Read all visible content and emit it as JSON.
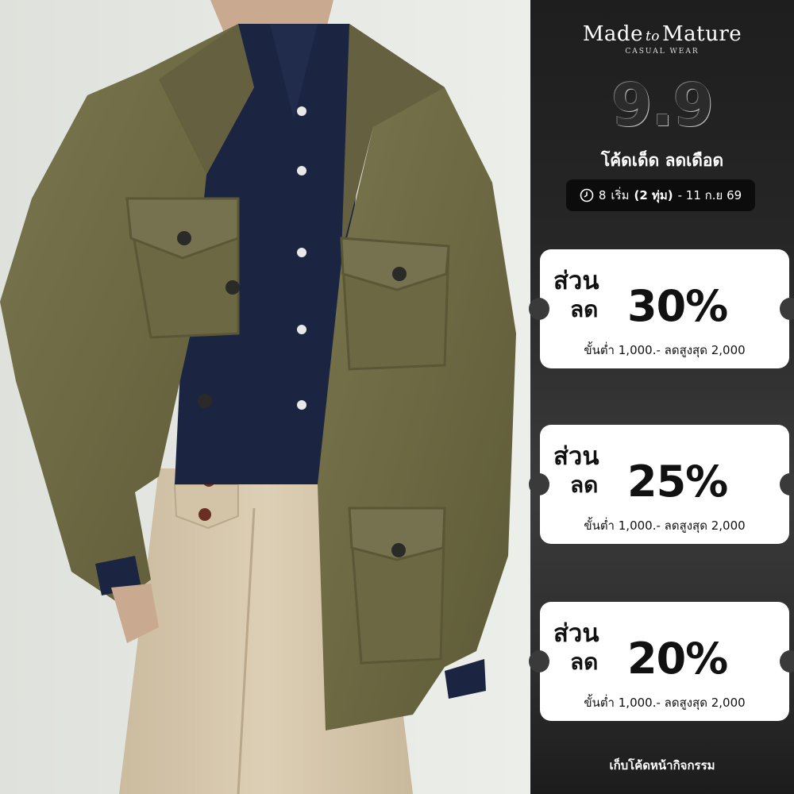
{
  "brand": {
    "name_left": "Made",
    "name_to": "to",
    "name_right": "Mature",
    "subtitle": "CASUAL WEAR"
  },
  "campaign": {
    "headline": "9.9",
    "slogan": "โค้ดเด็ด ลดเดือด",
    "date_icon": "clock-icon",
    "date_start": "8",
    "date_start_label": "เริ่ม",
    "date_time": "(2 ทุ่ม)",
    "date_end": "- 11 ก.ย 69"
  },
  "coupons": [
    {
      "word1": "ส่วน",
      "word2": "ลด",
      "percent": "30%",
      "terms": "ขั้นต่ำ 1,000.- ลดสูงสุด 2,000"
    },
    {
      "word1": "ส่วน",
      "word2": "ลด",
      "percent": "25%",
      "terms": "ขั้นต่ำ 1,000.- ลดสูงสุด 2,000"
    },
    {
      "word1": "ส่วน",
      "word2": "ลด",
      "percent": "20%",
      "terms": "ขั้นต่ำ 1,000.- ลดสูงสุด 2,000"
    }
  ],
  "footer": "เก็บโค้ดหน้ากิจกรรม",
  "colors": {
    "jacket": "#6f6b45",
    "shirt": "#1b2440",
    "trousers": "#d8c9ae",
    "panel_bg": "#2a2a2a",
    "coupon_bg": "#ffffff"
  }
}
